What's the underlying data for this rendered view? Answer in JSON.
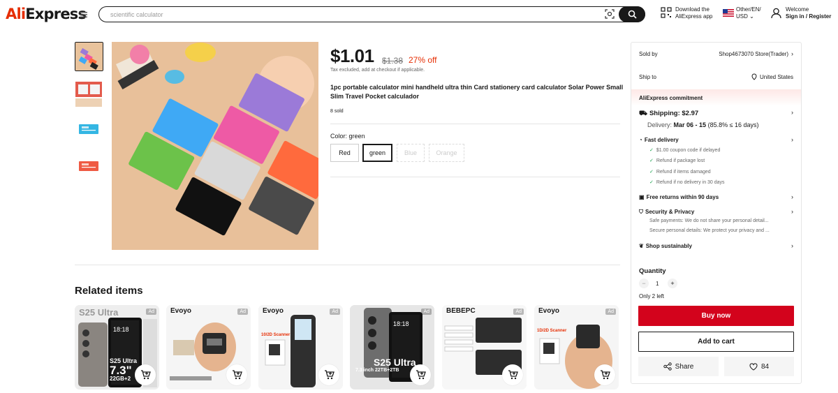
{
  "header": {
    "logo_part1": "Ali",
    "logo_part2": "Express",
    "search_placeholder": "scientific calculator",
    "download_line1": "Download the",
    "download_line2": "AliExpress app",
    "locale_line1": "Other/EN/",
    "locale_line2": "USD",
    "welcome_line1": "Welcome",
    "welcome_line2": "Sign in / Register"
  },
  "product": {
    "price": "$1.01",
    "old_price": "$1.38",
    "discount": "27% off",
    "tax_note": "Tax excluded, add at checkout if applicable.",
    "title": "1pc portable calculator mini handheld ultra thin Card stationery card calculator Solar Power Small Slim Travel Pocket calculador",
    "sold": "8 sold",
    "color_label": "Color: green",
    "colors": [
      "Red",
      "green",
      "Blue",
      "Orange"
    ],
    "selected_color": "green"
  },
  "related": {
    "title": "Related items",
    "items": [
      {
        "brand": "S25 Ultra",
        "ad": "Ad",
        "caption1": "S25 Ultra",
        "caption2": "7.3\"",
        "caption3": "22GB+2"
      },
      {
        "brand": "Evoyo",
        "ad": "Ad"
      },
      {
        "brand": "Evoyo",
        "ad": "Ad",
        "caption1": "10/2D Scanner"
      },
      {
        "brand": "",
        "ad": "Ad",
        "caption1": "S25 Ultra",
        "caption2": "7.3 inch 22TB+2TB"
      },
      {
        "brand": "BEBEPC",
        "ad": "Ad"
      },
      {
        "brand": "Evoyo",
        "ad": "Ad",
        "caption1": "1D/2D Scanner"
      }
    ]
  },
  "panel": {
    "sold_by_label": "Sold by",
    "store": "Shop4673070 Store(Trader)",
    "ship_to_label": "Ship to",
    "ship_to": "United States",
    "commitment": "AliExpress commitment",
    "shipping": "Shipping: $2.97",
    "delivery_label": "Delivery:",
    "delivery_dates": "Mar 06 - 15",
    "delivery_note": "(85.8% ≤ 16 days)",
    "fast_delivery": "Fast delivery",
    "fast_items": [
      "$1.00 coupon code if delayed",
      "Refund if package lost",
      "Refund if items damaged",
      "Refund if no delivery in 30 days"
    ],
    "free_returns": "Free returns within 90 days",
    "security": "Security & Privacy",
    "security_items": [
      "Safe payments: We do not share your personal detail...",
      "Secure personal details: We protect your privacy and ..."
    ],
    "sustainably": "Shop sustainably",
    "quantity_label": "Quantity",
    "quantity": "1",
    "stock_note": "Only 2 left",
    "buy_now": "Buy now",
    "add_to_cart": "Add to cart",
    "share": "Share",
    "likes": "84"
  }
}
